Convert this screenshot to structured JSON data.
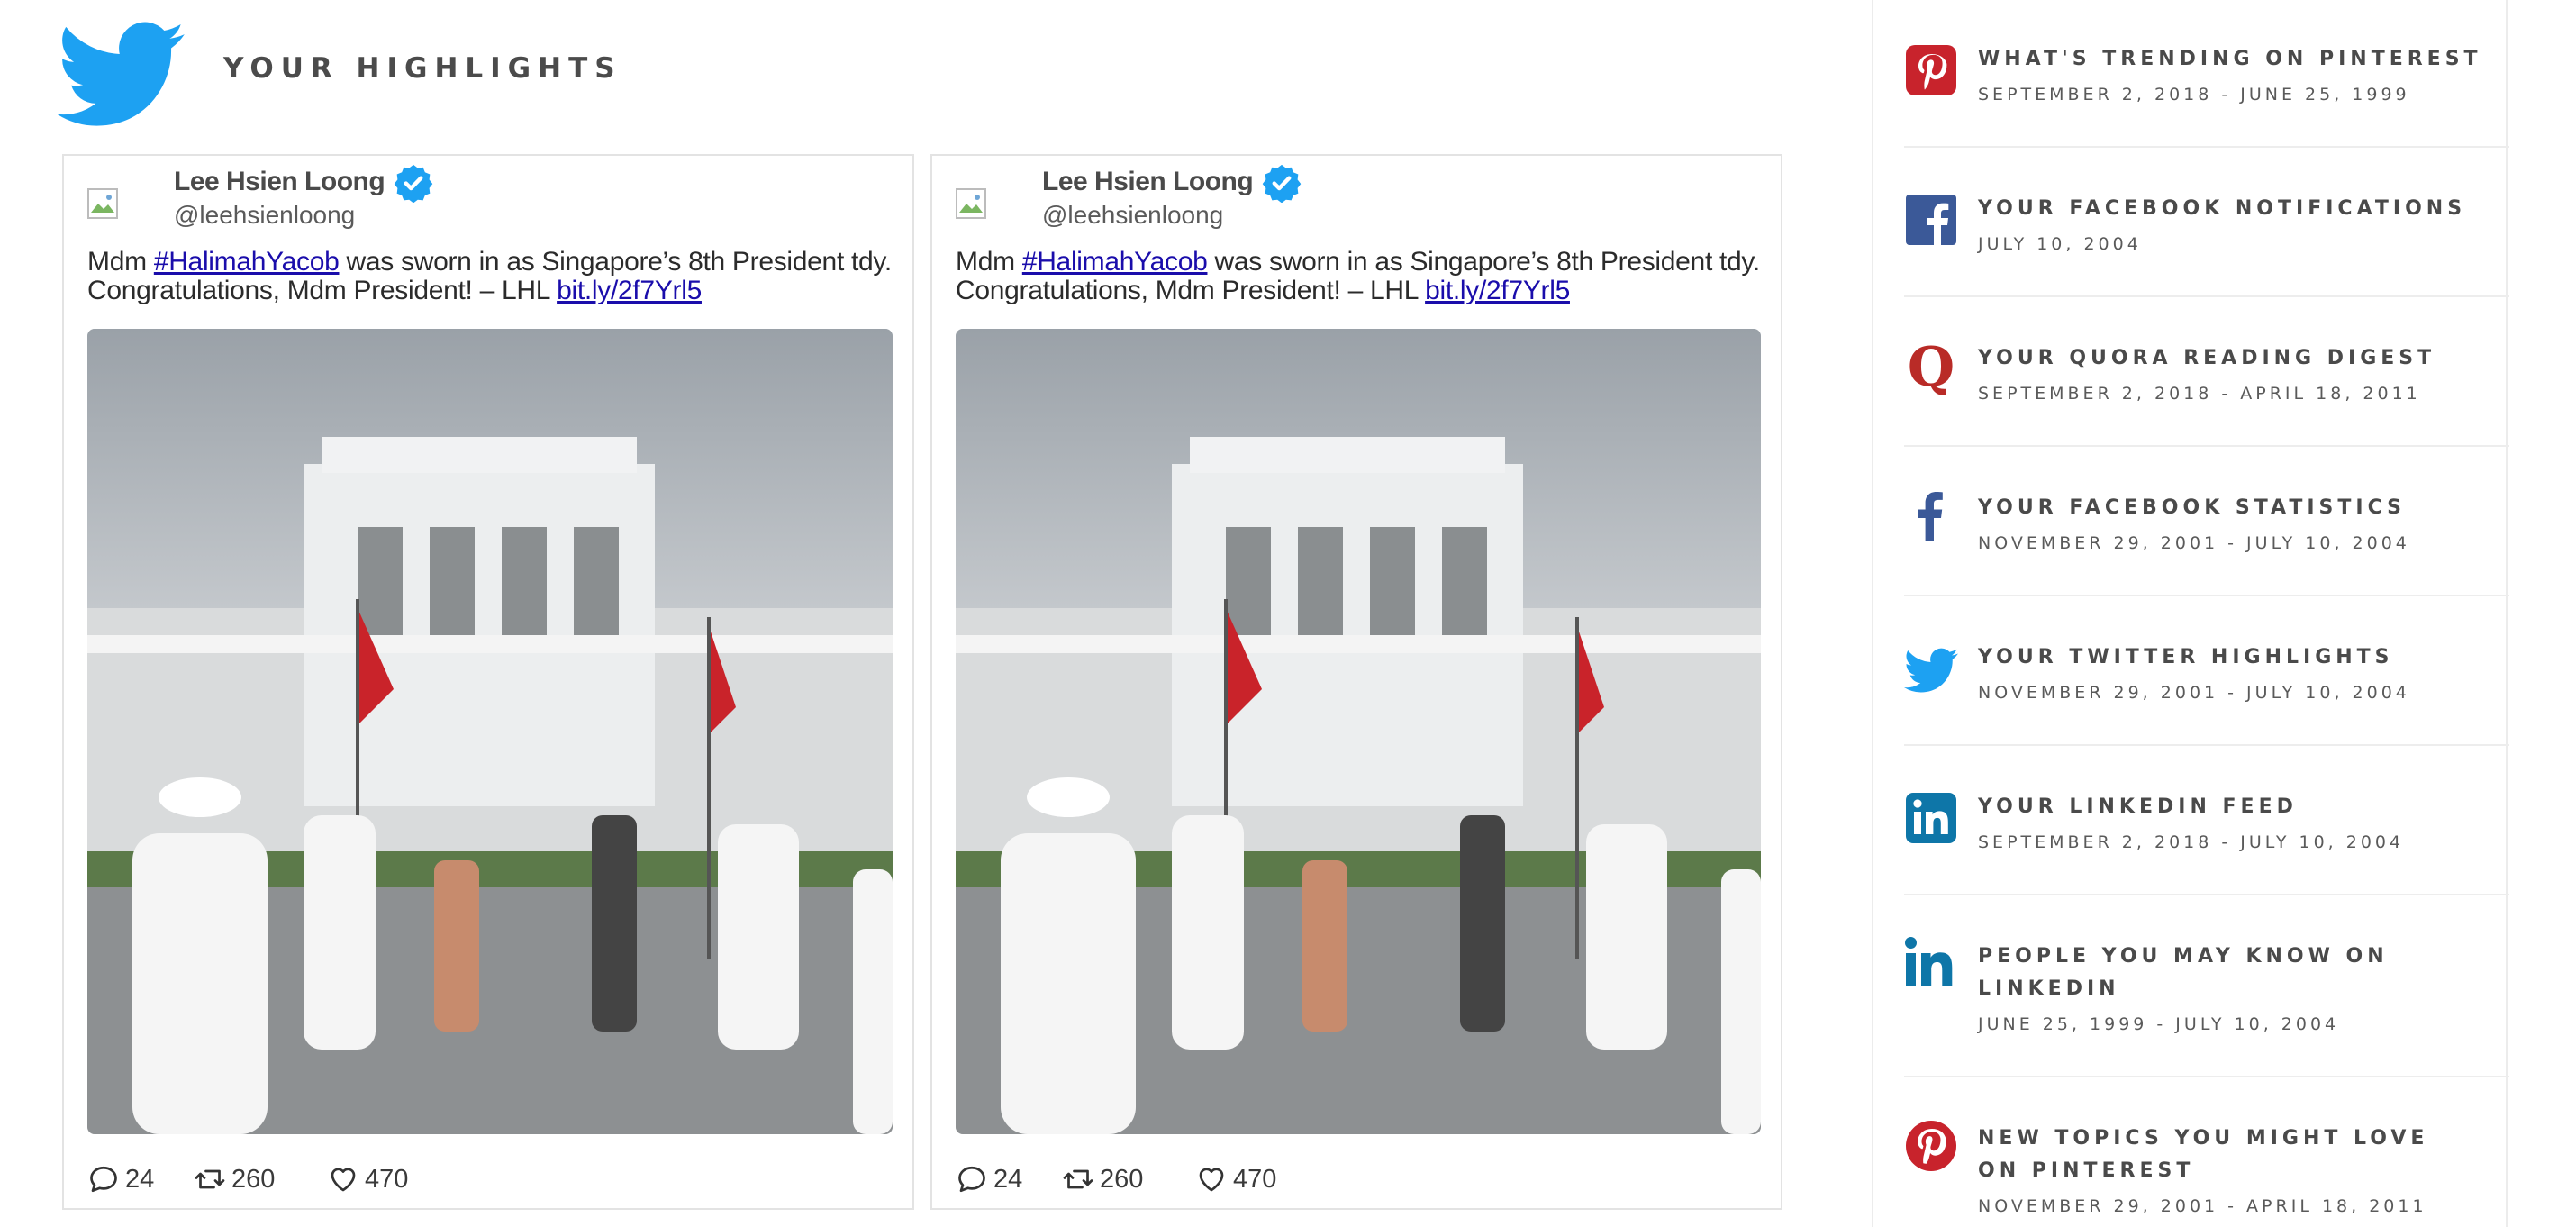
{
  "header": {
    "title": "YOUR HIGHLIGHTS",
    "logo_icon": "twitter-bird-icon",
    "brand_color": "#1da1f2"
  },
  "tweets": [
    {
      "author": "Lee Hsien Loong",
      "handle": "@leehsienloong",
      "text_before": "Mdm ",
      "hashtag": "#HalimahYacob",
      "text_middle": " was sworn in as Singapore’s 8th President tdy. Congratulations, Mdm President! – LHL ",
      "link": "bit.ly/2f7Yrl5",
      "replies": "24",
      "retweets": "260",
      "likes": "470"
    },
    {
      "author": "Lee Hsien Loong",
      "handle": "@leehsienloong",
      "text_before": "Mdm ",
      "hashtag": "#HalimahYacob",
      "text_middle": " was sworn in as Singapore’s 8th President tdy. Congratulations, Mdm President! – LHL ",
      "link": "bit.ly/2f7Yrl5",
      "replies": "24",
      "retweets": "260",
      "likes": "470"
    }
  ],
  "sidebar": {
    "items": [
      {
        "title": "WHAT'S TRENDING ON PINTEREST",
        "date": "SEPTEMBER 2, 2018 - JUNE 25, 1999",
        "icon": "pinterest-icon",
        "color": "#c8232c"
      },
      {
        "title": "YOUR FACEBOOK NOTIFICATIONS",
        "date": "JULY 10, 2004",
        "icon": "facebook-square-icon",
        "color": "#3b5998"
      },
      {
        "title": "YOUR QUORA READING DIGEST",
        "date": "SEPTEMBER 2, 2018 - APRIL 18, 2011",
        "icon": "quora-icon",
        "color": "#b92b27"
      },
      {
        "title": "YOUR FACEBOOK STATISTICS",
        "date": "NOVEMBER 29, 2001 - JULY 10, 2004",
        "icon": "facebook-f-icon",
        "color": "#3b5998"
      },
      {
        "title": "YOUR TWITTER HIGHLIGHTS",
        "date": "NOVEMBER 29, 2001 - JULY 10, 2004",
        "icon": "twitter-icon",
        "color": "#1da1f2"
      },
      {
        "title": "YOUR LINKEDIN FEED",
        "date": "SEPTEMBER 2, 2018 - JULY 10, 2004",
        "icon": "linkedin-square-icon",
        "color": "#0e76a8"
      },
      {
        "title": "PEOPLE YOU MAY KNOW ON LINKEDIN",
        "date": "JUNE 25, 1999 - JULY 10, 2004",
        "icon": "linkedin-in-icon",
        "color": "#0e76a8"
      },
      {
        "title": "NEW TOPICS YOU MIGHT LOVE ON PINTEREST",
        "date": "NOVEMBER 29, 2001 - APRIL 18, 2011",
        "icon": "pinterest-circle-icon",
        "color": "#c8232c"
      }
    ]
  }
}
